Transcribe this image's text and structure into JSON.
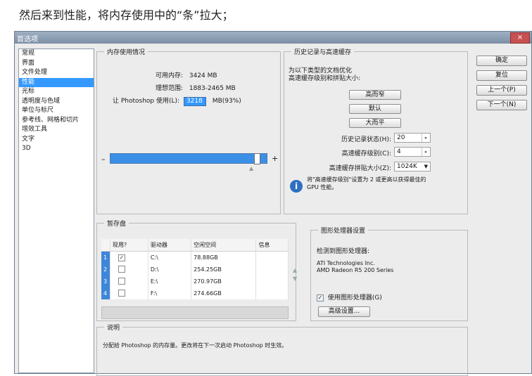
{
  "caption": "然后来到性能，将内存使用中的“条”拉大；",
  "window": {
    "title": "首选项",
    "close": "×"
  },
  "categories": [
    "常规",
    "界面",
    "文件处理",
    "性能",
    "光标",
    "透明度与色域",
    "单位与标尺",
    "参考线、网格和切片",
    "增效工具",
    "文字",
    "3D"
  ],
  "selected_category": "性能",
  "memory": {
    "legend": "内存使用情况",
    "available_label": "可用内存:",
    "available_value": "3424 MB",
    "ideal_label": "理想范围:",
    "ideal_value": "1883-2465 MB",
    "let_label": "让 Photoshop 使用(L):",
    "let_value": "3218",
    "let_suffix": "MB(93%)",
    "minus": "–",
    "plus": "+",
    "slider_fraction": 0.93
  },
  "history": {
    "legend": "历史记录与高速缓存",
    "desc": "为以下类型的文档优化\n高速缓存级别和拼贴大小:",
    "buttons": [
      "高而窄",
      "默认",
      "大而平"
    ],
    "history_states_label": "历史记录状态(H):",
    "history_states_value": "20",
    "cache_levels_label": "高速缓存级别(C):",
    "cache_levels_value": "4",
    "tile_size_label": "高速缓存拼贴大小(Z):",
    "tile_size_value": "1024K",
    "info": "将\"高速缓存级别\"设置为 2 或更高以获得最佳的\nGPU 性能。"
  },
  "scratch": {
    "legend": "暂存盘",
    "columns": [
      "现用?",
      "驱动器",
      "空闲空间",
      "信息"
    ],
    "rows": [
      {
        "num": "1",
        "active": true,
        "drive": "C:\\",
        "free": "78.88GB",
        "info": ""
      },
      {
        "num": "2",
        "active": false,
        "drive": "D:\\",
        "free": "254.25GB",
        "info": ""
      },
      {
        "num": "3",
        "active": false,
        "drive": "E:\\",
        "free": "270.97GB",
        "info": ""
      },
      {
        "num": "4",
        "active": false,
        "drive": "F:\\",
        "free": "274.66GB",
        "info": ""
      }
    ]
  },
  "gpu": {
    "legend": "图形处理器设置",
    "detected_label": "检测到图形处理器:",
    "vendor": "ATI Technologies Inc.",
    "model": "AMD Radeon R5 200 Series",
    "use_gpu_label": "使用图形处理器(G)",
    "advanced_button": "高级设置..."
  },
  "description": {
    "legend": "说明",
    "text": "分配给 Photoshop 的内存量。更改将在下一次启动 Photoshop 时生效。"
  },
  "side_buttons": [
    "确定",
    "复位",
    "上一个(P)",
    "下一个(N)"
  ]
}
